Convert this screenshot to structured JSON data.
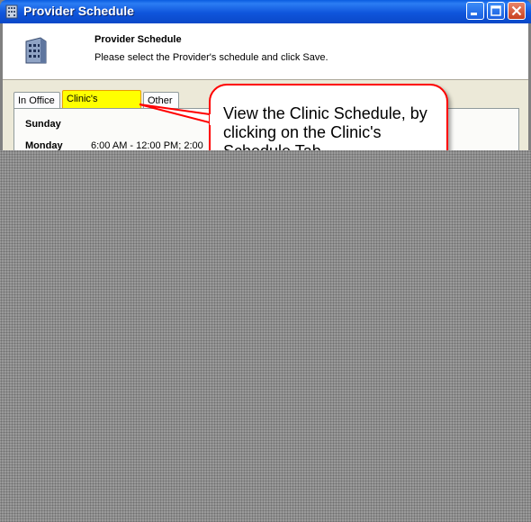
{
  "window": {
    "title": "Provider Schedule"
  },
  "header": {
    "title": "Provider Schedule",
    "subtitle": "Please select the Provider's schedule and click Save."
  },
  "tabs": [
    {
      "label": "In Office"
    },
    {
      "label": "Clinic's Schedule"
    },
    {
      "label": "Other"
    }
  ],
  "schedule": [
    {
      "day": "Sunday",
      "hours": ""
    },
    {
      "day": "Monday",
      "hours": "6:00 AM - 12:00 PM; 2:00"
    }
  ],
  "callout": {
    "text": "View the Clinic Schedule, by clicking on the Clinic's Schedule Tab"
  },
  "colors": {
    "highlight": "#ffff00",
    "callout_border": "#ff0000",
    "titlebar": "#0a5ce0"
  }
}
